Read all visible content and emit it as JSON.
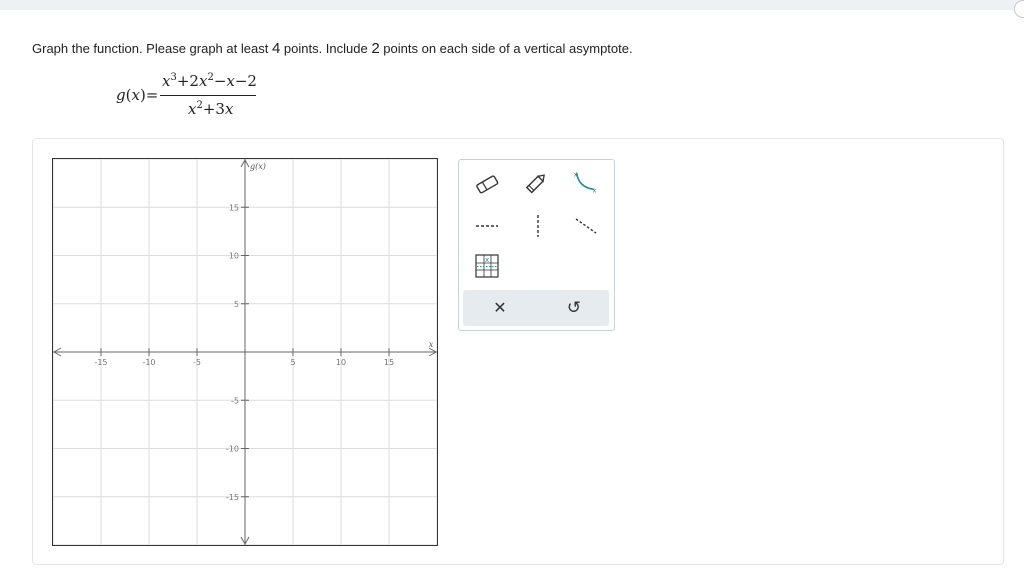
{
  "question": {
    "part1": "Graph the function. Please graph at least ",
    "n1": "4",
    "part2": " points. Include ",
    "n2": "2",
    "part3": " points on each side of a vertical asymptote."
  },
  "formula": {
    "lhs_fn": "g",
    "lhs_var": "x",
    "num_a": "x",
    "num_a_exp": "3",
    "num_b": "+2",
    "num_b_var": "x",
    "num_b_exp": "2",
    "num_c": "−",
    "num_c_var": "x",
    "num_d": "−2",
    "den_a": "x",
    "den_a_exp": "2",
    "den_b": "+3",
    "den_b_var": "x"
  },
  "graph": {
    "x_label": "x",
    "y_label": "g(x)",
    "x_ticks": [
      "-15",
      "-10",
      "-5",
      "5",
      "10",
      "15"
    ],
    "y_ticks": [
      "15",
      "10",
      "5",
      "-5",
      "-10",
      "-15"
    ],
    "x_tick_values": [
      -15,
      -10,
      -5,
      5,
      10,
      15
    ],
    "y_tick_values": [
      15,
      10,
      5,
      -5,
      -10,
      -15
    ],
    "x_range": [
      -20,
      20
    ],
    "y_range": [
      -20,
      20
    ],
    "grid": true
  },
  "tools": {
    "eraser": "eraser-icon",
    "pencil": "pencil-icon",
    "curve": "curve-points-icon",
    "dashed_h": "horizontal-asymptote-icon",
    "dashed_v": "vertical-asymptote-icon",
    "dashed_slant": "slant-asymptote-icon",
    "point_table": "point-table-icon",
    "clear": "✕",
    "undo": "↺"
  },
  "colors": {
    "accent": "#2a8c9e",
    "toolbar_bg": "#e6ebef",
    "grid": "#dedede"
  }
}
